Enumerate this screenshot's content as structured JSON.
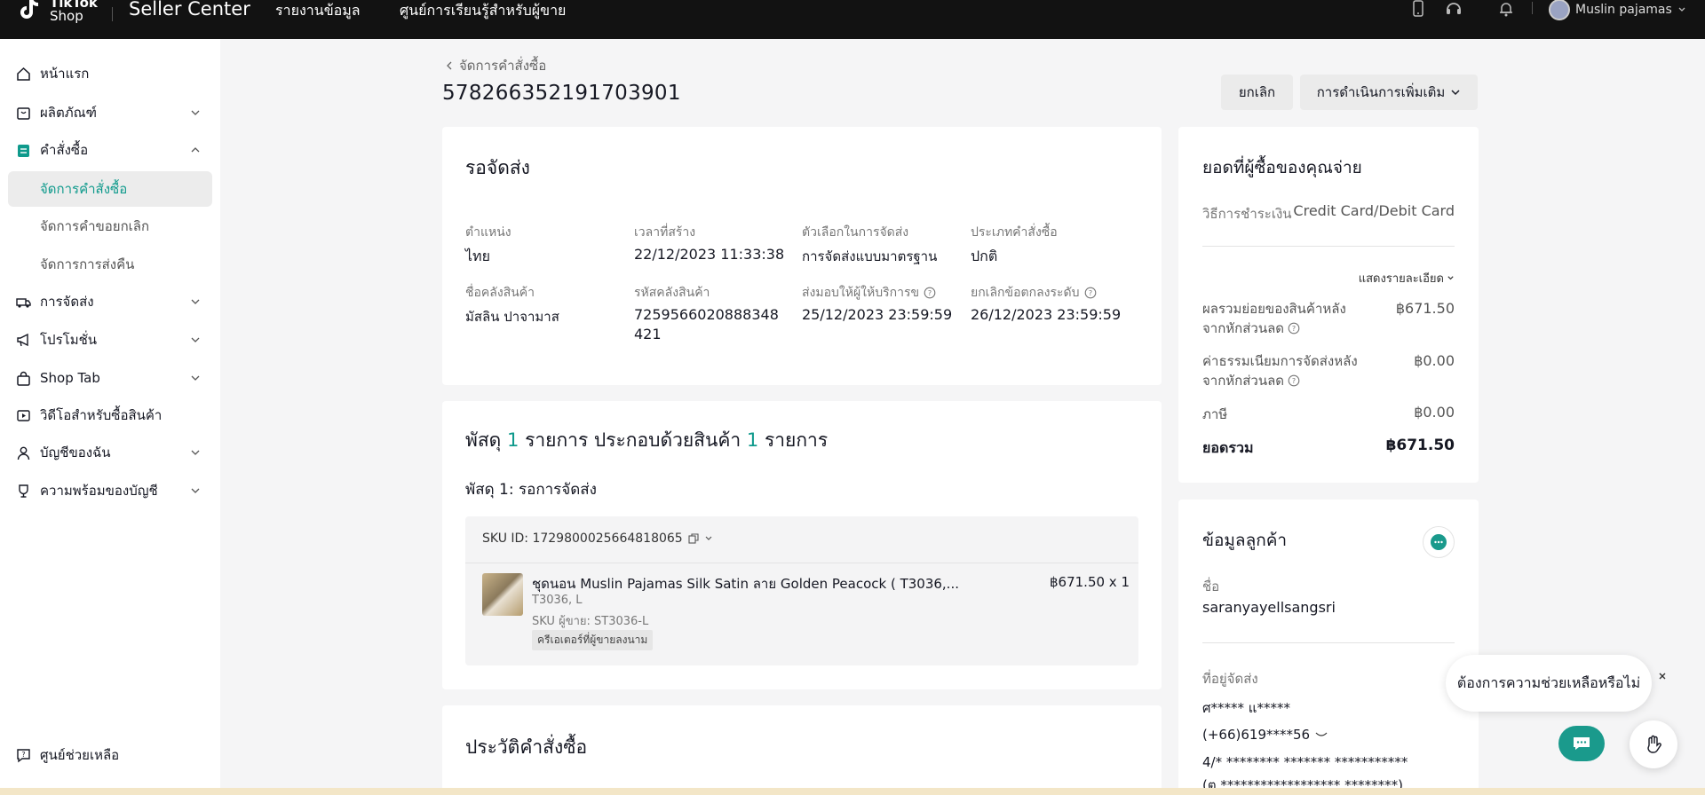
{
  "topbar": {
    "logo_line1": "TikTok",
    "logo_line2": "Shop",
    "app_name": "Seller Center",
    "nav": [
      "รายงานข้อมูล",
      "ศูนย์การเรียนรู้สำหรับผู้ขาย"
    ],
    "user_name": "Muslin pajamas"
  },
  "sidebar": {
    "items": [
      {
        "label": "หน้าแรก",
        "icon": "home-icon"
      },
      {
        "label": "ผลิตภัณฑ์",
        "icon": "product-icon"
      },
      {
        "label": "คำสั่งซื้อ",
        "icon": "orders-icon"
      },
      {
        "label": "การจัดส่ง",
        "icon": "shipping-icon"
      },
      {
        "label": "โปรโมชั่น",
        "icon": "megaphone-icon"
      },
      {
        "label": "Shop Tab",
        "icon": "shop-bag-icon"
      },
      {
        "label": "วิดีโอสำหรับซื้อสินค้า",
        "icon": "video-icon"
      },
      {
        "label": "บัญชีของฉัน",
        "icon": "user-icon"
      },
      {
        "label": "ความพร้อมของบัญชี",
        "icon": "trophy-icon"
      }
    ],
    "sub_items": [
      "จัดการคำสั่งซื้อ",
      "จัดการคำขอยกเลิก",
      "จัดการการส่งคืน"
    ],
    "help": "ศูนย์ช่วยเหลือ"
  },
  "header": {
    "breadcrumb": "จัดการคำสั่งซื้อ",
    "order_id": "578266352191703901",
    "cancel_btn": "ยกเลิก",
    "more_actions_btn": "การดำเนินการเพิ่มเติม"
  },
  "status_card": {
    "status": "รอจัดส่ง",
    "fields": [
      {
        "label": "ตำแหน่ง",
        "value": "ไทย"
      },
      {
        "label": "เวลาที่สร้าง",
        "value": "22/12/2023 11:33:38"
      },
      {
        "label": "ตัวเลือกในการจัดส่ง",
        "value": "การจัดส่งแบบมาตรฐาน"
      },
      {
        "label": "ประเภทคำสั่งซื้อ",
        "value": "ปกติ"
      },
      {
        "label": "ชื่อคลังสินค้า",
        "value": "มัสลิน ปาจามาส"
      },
      {
        "label": "รหัสคลังสินค้า",
        "value": "7259566020888348",
        "value2": "421"
      },
      {
        "label": "ส่งมอบให้ผู้ให้บริการข",
        "value": "25/12/2023 23:59:59"
      },
      {
        "label": "ยกเลิกข้อตกลงระดับ",
        "value": "26/12/2023 23:59:59"
      }
    ]
  },
  "package_card": {
    "title_prefix": "พัสดุ",
    "count1": "1",
    "title_mid": "รายการ ประกอบด้วยสินค้า",
    "count2": "1",
    "title_suffix": "รายการ",
    "package_label": "พัสดุ 1: รอการจัดส่ง",
    "sku_id": "SKU ID: 1729800025664818065",
    "product_name": "ชุดนอน Muslin Pajamas Silk Satin ลาย Golden Peacock ( T3036,...",
    "variant": "T3036, L",
    "seller_sku": "SKU ผู้ขาย: ST3036-L",
    "tag": "ครีเอเตอร์ที่ผู้ขายลงนาม",
    "price_qty": "฿671.50 x 1"
  },
  "history_card": {
    "title": "ประวัติคำสั่งซื้อ"
  },
  "payment_card": {
    "title": "ยอดที่ผู้ซื้อของคุณจ่าย",
    "method_label": "วิธีการชำระเงิน",
    "method_value": "Credit Card/Debit Card",
    "details_toggle": "แสดงรายละเอียด",
    "rows": [
      {
        "label1": "ผลรวมย่อยของสินค้าหลัง",
        "label2": "จากหักส่วนลด",
        "value": "฿671.50"
      },
      {
        "label1": "ค่าธรรมเนียมการจัดส่งหลัง",
        "label2": "จากหักส่วนลด",
        "value": "฿0.00"
      },
      {
        "label1": "ภาษี",
        "label2": "",
        "value": "฿0.00"
      }
    ],
    "total_label": "ยอดรวม",
    "total_value": "฿671.50"
  },
  "customer_card": {
    "title": "ข้อมูลลูกค้า",
    "name_label": "ชื่อ",
    "name_value": "saranyayellsangsri",
    "address_label": "ที่อยู่จัดส่ง",
    "recipient": "ศ***** แ*****",
    "phone": "(+66)619****56",
    "address1": "4/* ******** ******* ***********",
    "address2": "(ต.****************** ********)"
  },
  "help_widget": {
    "bubble_text": "ต้องการความช่วยเหลือหรือไม่"
  },
  "colors": {
    "accent": "#0f9a8c",
    "topbar": "#121212"
  }
}
